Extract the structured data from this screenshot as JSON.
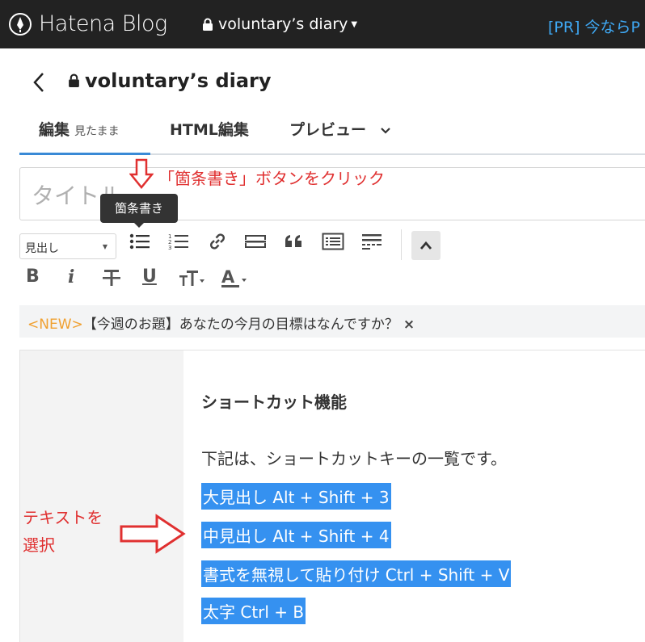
{
  "topbar": {
    "logo": "Hatena Blog",
    "blog_name": "voluntary’s diary",
    "pr_text": "[PR] 今ならP"
  },
  "header": {
    "title": "voluntary’s diary"
  },
  "tabs": [
    {
      "label": "編集",
      "sub": "見たまま"
    },
    {
      "label": "HTML編集"
    },
    {
      "label": "プレビュー"
    }
  ],
  "title_input": {
    "placeholder": "タイトル"
  },
  "tooltip": "箇条書き",
  "annotations": {
    "top": "「箇条書き」ボタンをクリック",
    "left_line1": "テキストを",
    "left_line2": "選択"
  },
  "toolbar": {
    "heading_select": "見出し",
    "format": {
      "bold": "B",
      "italic": "i",
      "underline": "U"
    }
  },
  "notice": {
    "new_tag": "<NEW>",
    "text": "【今週のお題】あなたの今月の目標はなんですか？",
    "close": "×"
  },
  "content": {
    "heading": "ショートカット機能",
    "intro": "下記は、ショートカットキーの一覧です。",
    "selected_lines": [
      "大見出し Alt + Shift + 3",
      "中見出し Alt + Shift + 4",
      "書式を無視して貼り付け Ctrl + Shift + V",
      "太字 Ctrl + B"
    ]
  },
  "colors": {
    "accent": "#3a8ad6",
    "selection": "#3591f0",
    "annotation": "#e03030",
    "new_tag": "#f0a030"
  }
}
